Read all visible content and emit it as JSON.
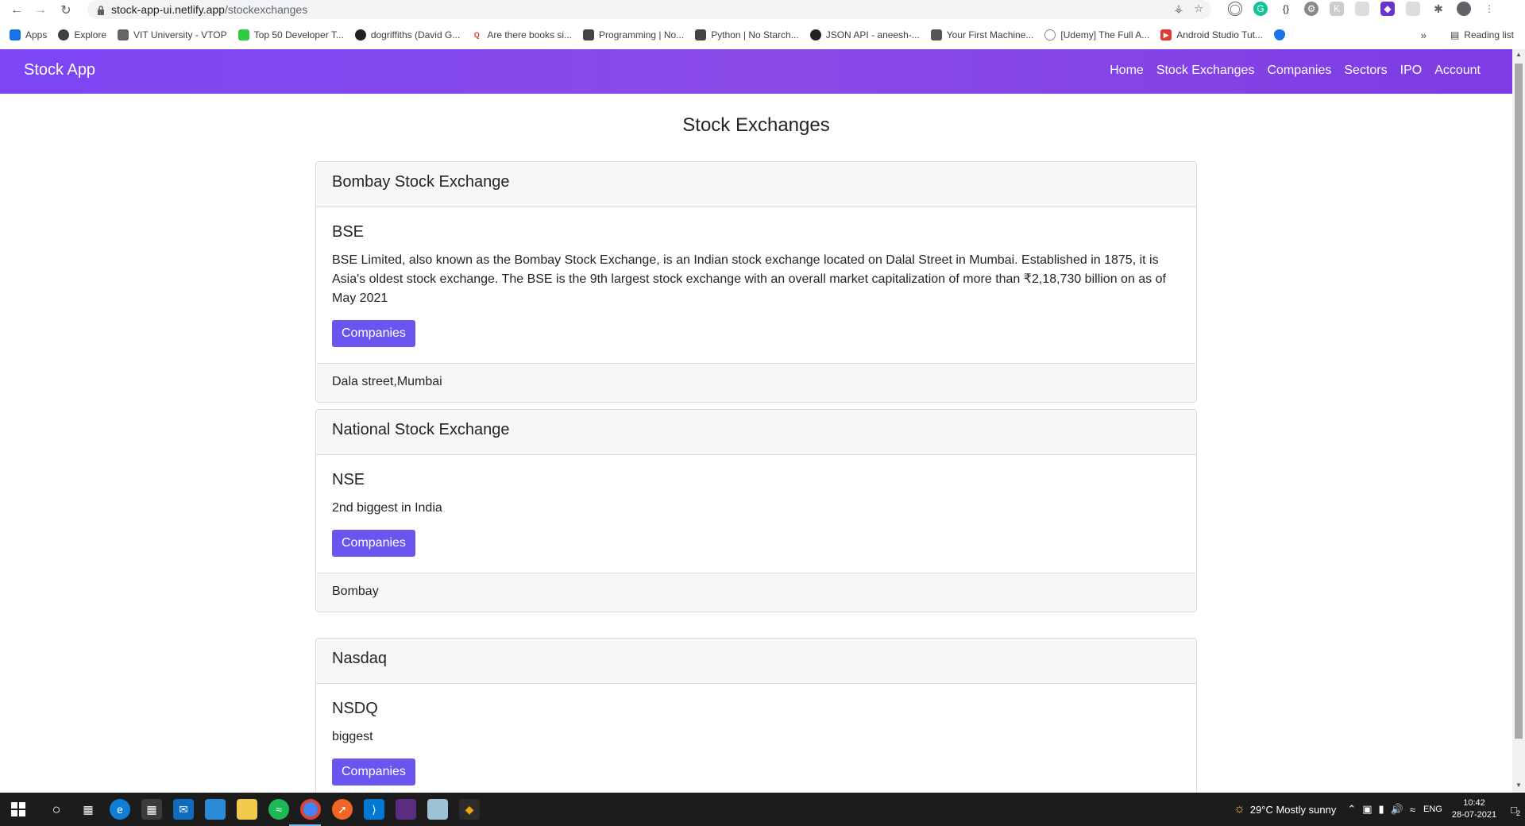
{
  "browser": {
    "url_host": "stock-app-ui.netlify.app",
    "url_path": "/stockexchanges",
    "bookmarks": [
      {
        "label": "Apps",
        "color": "#1a73e8"
      },
      {
        "label": "Explore",
        "color": "#3c4043"
      },
      {
        "label": "VIT University - VTOP",
        "color": "#666666"
      },
      {
        "label": "Top 50 Developer T...",
        "color": "#2ecc40"
      },
      {
        "label": "dogriffiths (David G...",
        "color": "#222222"
      },
      {
        "label": "Are there books si...",
        "color": "#e53935"
      },
      {
        "label": "Programming | No...",
        "color": "#444444"
      },
      {
        "label": "Python | No Starch...",
        "color": "#444444"
      },
      {
        "label": "JSON API - aneesh-...",
        "color": "#222222"
      },
      {
        "label": "Your First Machine...",
        "color": "#555555"
      },
      {
        "label": "[Udemy] The Full A...",
        "color": "#888888"
      },
      {
        "label": "Android Studio Tut...",
        "color": "#e53935"
      }
    ],
    "reading_list": "Reading list"
  },
  "navbar": {
    "brand": "Stock App",
    "links": [
      "Home",
      "Stock Exchanges",
      "Companies",
      "Sectors",
      "IPO",
      "Account"
    ],
    "color": "#7c46f4"
  },
  "page": {
    "title": "Stock Exchanges",
    "exchanges": [
      {
        "name": "Bombay Stock Exchange",
        "code": "BSE",
        "description": "BSE Limited, also known as the Bombay Stock Exchange, is an Indian stock exchange located on Dalal Street in Mumbai. Established in 1875, it is Asia's oldest stock exchange. The BSE is the 9th largest stock exchange with an overall market capitalization of more than ₹2,18,730 billion on as of May 2021",
        "button": "Companies",
        "address": "Dala street,Mumbai"
      },
      {
        "name": "National Stock Exchange",
        "code": "NSE",
        "description": "2nd biggest in India",
        "button": "Companies",
        "address": "Bombay"
      },
      {
        "name": "Nasdaq",
        "code": "NSDQ",
        "description": "biggest",
        "button": "Companies",
        "address": ""
      }
    ]
  },
  "taskbar": {
    "weather": "29°C  Mostly sunny",
    "lang": "ENG",
    "time": "10:42",
    "date": "28-07-2021",
    "notifications": "2"
  }
}
